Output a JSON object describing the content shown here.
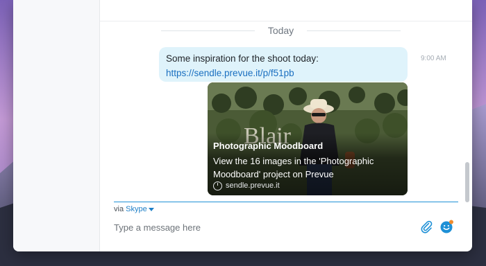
{
  "chat": {
    "day_separator": "Today",
    "message": {
      "text": "Some inspiration for the shoot today:",
      "link": "https://sendle.prevue.it/p/f51pb",
      "time": "9:00 AM"
    },
    "link_preview": {
      "title": "Photographic Moodboard",
      "description": "View the 16 images in the 'Photographic Moodboard' project on Prevue",
      "source": "sendle.prevue.it",
      "photo_text": "Blair"
    }
  },
  "composer": {
    "via_label": "via",
    "service": "Skype",
    "placeholder": "Type a message here",
    "accent_color": "#1e90d6"
  },
  "icons": {
    "attach": "paperclip-icon",
    "emoji": "emoji-icon",
    "link_source": "globe-icon"
  }
}
